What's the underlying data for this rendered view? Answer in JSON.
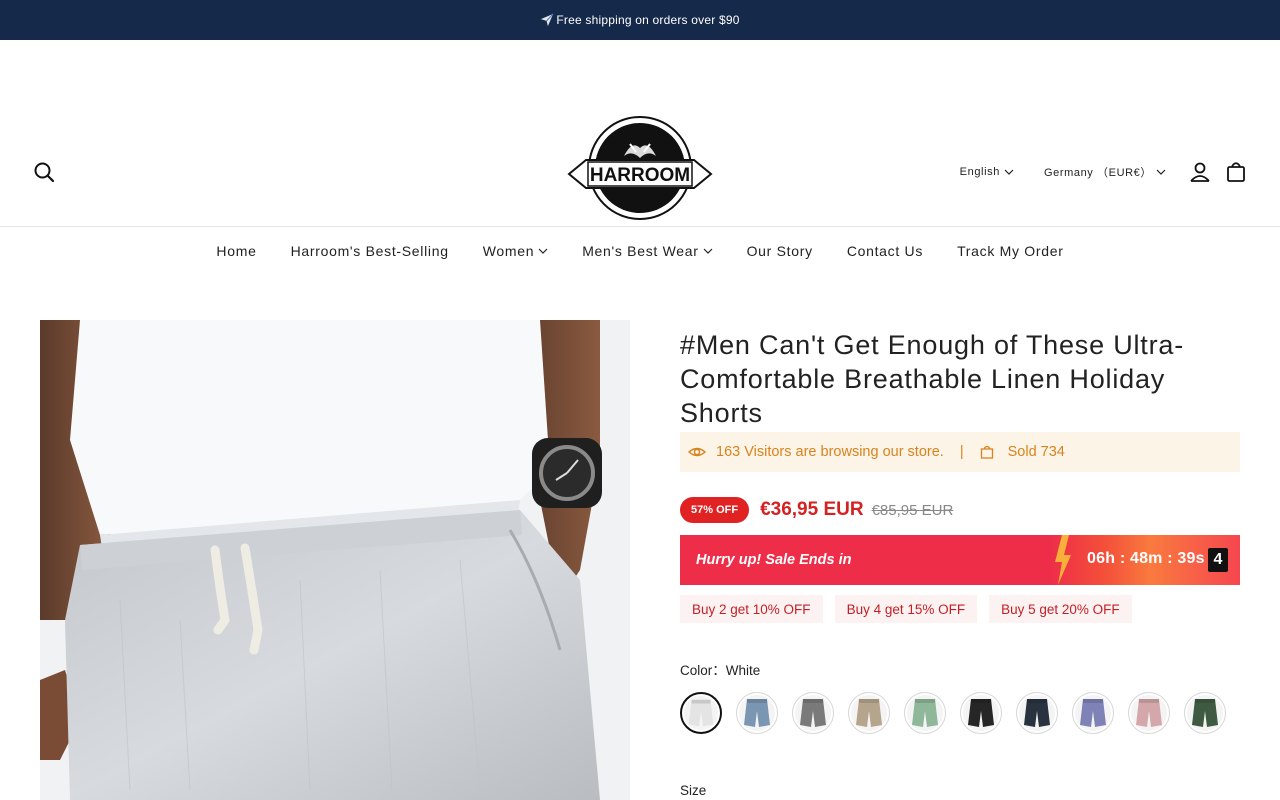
{
  "announcement": {
    "text": "Free shipping on orders over $90"
  },
  "header": {
    "logo_text": "HARROOM",
    "language": "English",
    "country": "Germany （EUR€）"
  },
  "nav": [
    {
      "label": "Home",
      "has_dropdown": false
    },
    {
      "label": "Harroom's Best-Selling",
      "has_dropdown": false
    },
    {
      "label": "Women",
      "has_dropdown": true
    },
    {
      "label": "Men's Best Wear",
      "has_dropdown": true
    },
    {
      "label": "Our Story",
      "has_dropdown": false
    },
    {
      "label": "Contact Us",
      "has_dropdown": false
    },
    {
      "label": "Track My Order",
      "has_dropdown": false
    }
  ],
  "product": {
    "title": "#Men Can't Get Enough of These Ultra-Comfortable Breathable Linen Holiday Shorts",
    "visitors_text": "163 Visitors are browsing our store.",
    "separator": "|",
    "sold_text": "Sold 734",
    "discount_badge": "57% OFF",
    "price": "€36,95 EUR",
    "compare_price": "€85,95 EUR",
    "countdown": {
      "label": "Hurry up! Sale Ends in",
      "time": "06h : 48m : 39s",
      "extra_digit": "4"
    },
    "bundles": [
      {
        "label": "Buy 2 get 10% OFF"
      },
      {
        "label": "Buy 4 get 15% OFF"
      },
      {
        "label": "Buy 5 get 20% OFF"
      }
    ],
    "color_label": "Color：White",
    "swatches": [
      {
        "name": "white",
        "color": "#e4e4e4",
        "selected": true
      },
      {
        "name": "blue",
        "color": "#7b96b3",
        "selected": false
      },
      {
        "name": "gray",
        "color": "#7a7a7a",
        "selected": false
      },
      {
        "name": "khaki",
        "color": "#b6a58d",
        "selected": false
      },
      {
        "name": "green",
        "color": "#8fb79a",
        "selected": false
      },
      {
        "name": "black",
        "color": "#262626",
        "selected": false
      },
      {
        "name": "navy",
        "color": "#29333f",
        "selected": false
      },
      {
        "name": "purple",
        "color": "#7f82b7",
        "selected": false
      },
      {
        "name": "pink",
        "color": "#d4a8aa",
        "selected": false
      },
      {
        "name": "dark-green",
        "color": "#3e5a40",
        "selected": false
      }
    ],
    "size_label": "Size"
  },
  "colors": {
    "announcement_bg": "#15294a",
    "sale_red": "#e02222",
    "visitor_orange": "#d9831f",
    "visitor_bg": "#fcf4e6"
  }
}
